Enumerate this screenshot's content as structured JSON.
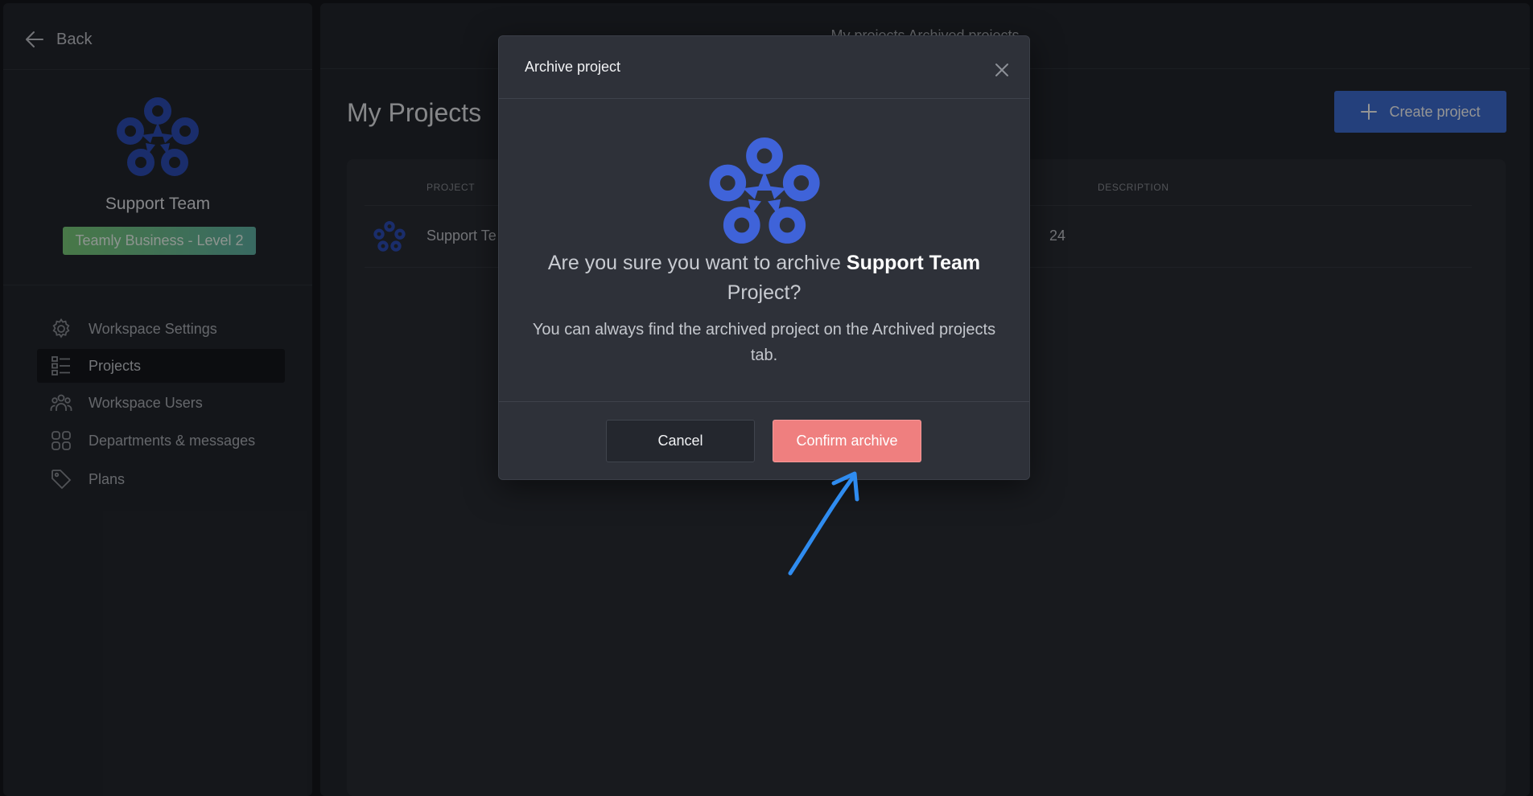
{
  "sidebar": {
    "back_label": "Back",
    "team_name": "Support Team",
    "plan_badge": "Teamly Business - Level 2",
    "items": [
      {
        "label": "Workspace Settings",
        "icon": "gear-icon"
      },
      {
        "label": "Projects",
        "icon": "list-icon",
        "active": true
      },
      {
        "label": "Workspace Users",
        "icon": "users-icon"
      },
      {
        "label": "Departments & messages",
        "icon": "grid-icon"
      },
      {
        "label": "Plans",
        "icon": "tag-icon"
      }
    ]
  },
  "main": {
    "breadcrumb": "My projects    Archived projects",
    "page_title": "My Projects",
    "create_button": "Create project",
    "table": {
      "columns": [
        "PROJECT",
        "DESCRIPTION"
      ],
      "rows": [
        {
          "project": "Support Te",
          "description": "24"
        }
      ]
    }
  },
  "modal": {
    "title": "Archive project",
    "heading_prefix": "Are you sure you want to archive ",
    "heading_bold": "Support Team",
    "heading_suffix": " Project?",
    "body": "You can always find the archived project on the Archived projects tab.",
    "cancel_label": "Cancel",
    "confirm_label": "Confirm archive"
  },
  "colors": {
    "brand_blue": "#3f63d9",
    "confirm_red": "#ef7f7f",
    "annotation_arrow": "#2f8cf0"
  }
}
